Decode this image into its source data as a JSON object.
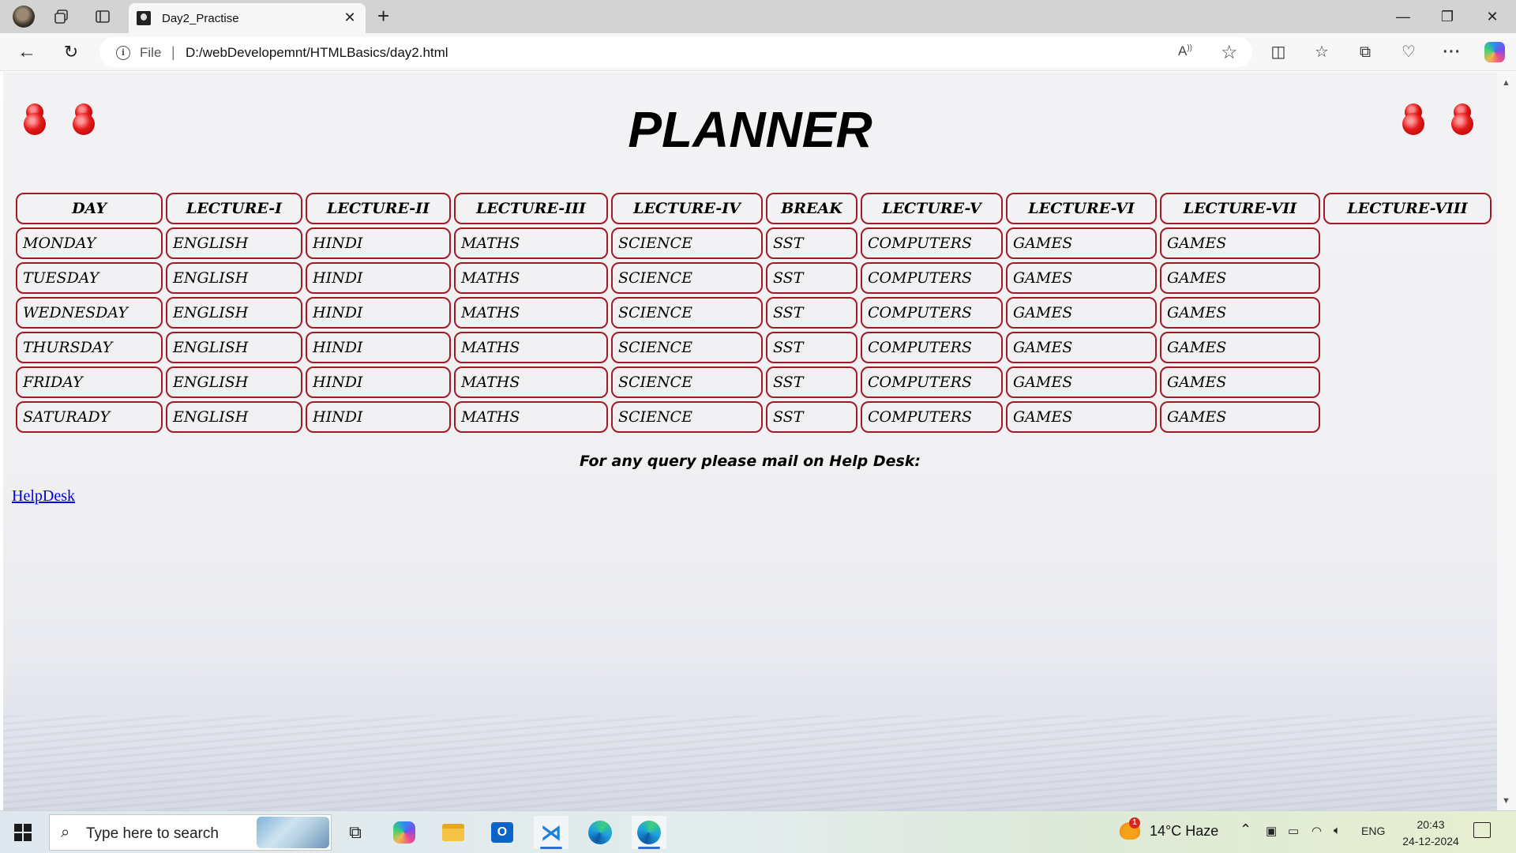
{
  "browser": {
    "tab_title": "Day2_Practise",
    "tab_close": "✕",
    "new_tab": "+",
    "file_label": "File",
    "separator": "|",
    "url": "D:/webDevelopemnt/HTMLBasics/day2.html",
    "window_controls": {
      "minimize": "—",
      "maximize": "❐",
      "close": "✕"
    }
  },
  "page": {
    "title": "PLANNER",
    "table": {
      "headers": [
        "DAY",
        "LECTURE-I",
        "LECTURE-II",
        "LECTURE-III",
        "LECTURE-IV",
        "LECTURE-V",
        "LECTURE-VI",
        "LECTURE-VII",
        "LECTURE-VIII"
      ],
      "break_label": "BREAK",
      "rows": [
        [
          "MONDAY",
          "ENGLISH",
          "HINDI",
          "MATHS",
          "SCIENCE",
          "SST",
          "COMPUTERS",
          "GAMES",
          "GAMES"
        ],
        [
          "TUESDAY",
          "ENGLISH",
          "HINDI",
          "MATHS",
          "SCIENCE",
          "SST",
          "COMPUTERS",
          "GAMES",
          "GAMES"
        ],
        [
          "WEDNESDAY",
          "ENGLISH",
          "HINDI",
          "MATHS",
          "SCIENCE",
          "SST",
          "COMPUTERS",
          "GAMES",
          "GAMES"
        ],
        [
          "THURSDAY",
          "ENGLISH",
          "HINDI",
          "MATHS",
          "SCIENCE",
          "SST",
          "COMPUTERS",
          "GAMES",
          "GAMES"
        ],
        [
          "FRIDAY",
          "ENGLISH",
          "HINDI",
          "MATHS",
          "SCIENCE",
          "SST",
          "COMPUTERS",
          "GAMES",
          "GAMES"
        ],
        [
          "SATURADY",
          "ENGLISH",
          "HINDI",
          "MATHS",
          "SCIENCE",
          "SST",
          "COMPUTERS",
          "GAMES",
          "GAMES"
        ]
      ]
    },
    "query_text": "For any query please mail on Help Desk:",
    "helpdesk_link": "HelpDesk"
  },
  "taskbar": {
    "search_placeholder": "Type here to search",
    "weather": "14°C  Haze",
    "weather_badge": "1",
    "language": "ENG",
    "time": "20:43",
    "date": "24-12-2024"
  },
  "colors": {
    "cell_border": "#a01b25",
    "link": "#0000ee"
  },
  "icons": {
    "pins": "red-pushpin-icon"
  }
}
